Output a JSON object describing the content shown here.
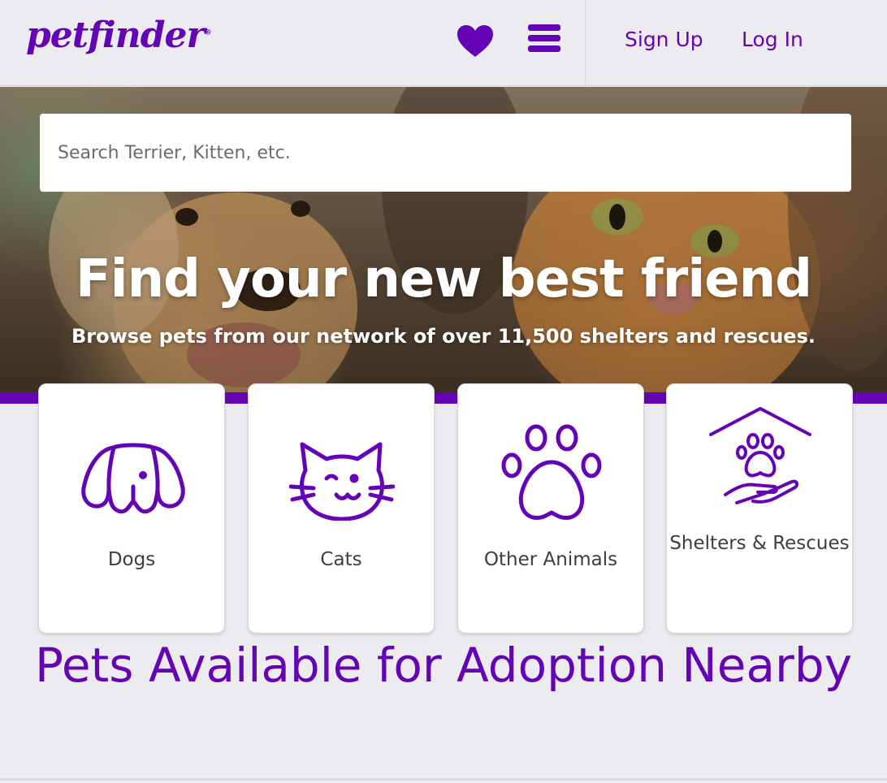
{
  "header": {
    "logo_text": "petfinder",
    "logo_mark": "®",
    "favorites_icon": "heart-icon",
    "menu_icon": "hamburger-menu-icon",
    "signup_label": "Sign Up",
    "login_label": "Log In"
  },
  "hero": {
    "search_placeholder": "Search Terrier, Kitten, etc.",
    "title": "Find your new best friend",
    "subtitle": "Browse pets from our network of over 11,500 shelters and rescues."
  },
  "categories": [
    {
      "label": "Dogs",
      "icon": "dog-icon"
    },
    {
      "label": "Cats",
      "icon": "cat-icon"
    },
    {
      "label": "Other Animals",
      "icon": "paw-icon"
    },
    {
      "label": "Shelters & Rescues",
      "icon": "shelter-hand-icon"
    }
  ],
  "section": {
    "title": "Pets Available for Adoption Nearby"
  },
  "colors": {
    "brand_purple": "#6504b5",
    "background": "#ecebef",
    "card": "#ffffff"
  }
}
